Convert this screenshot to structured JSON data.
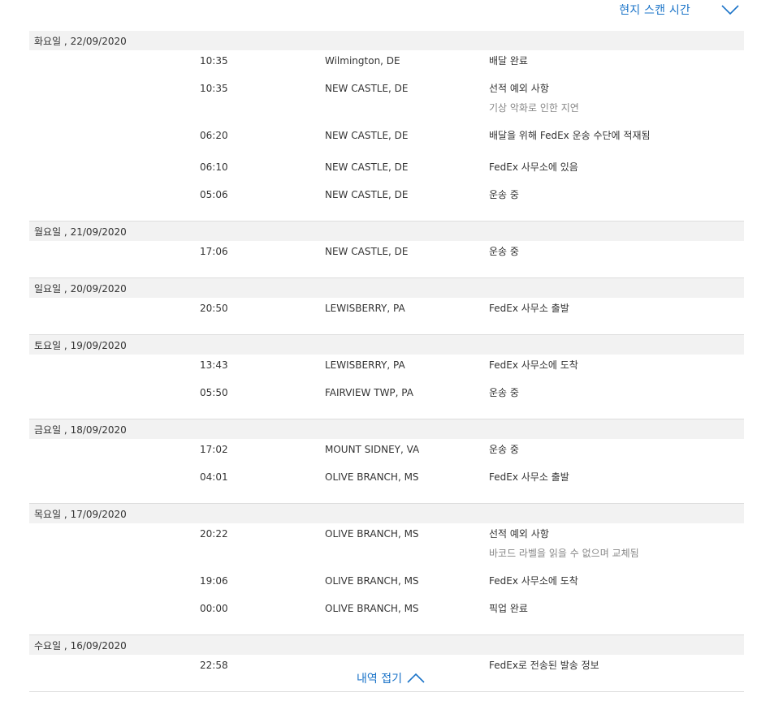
{
  "header": {
    "scan_time_label": "현지 스캔 시간"
  },
  "days": [
    {
      "date": "화요일 , 22/09/2020",
      "events": [
        {
          "time": "10:35",
          "location": "Wilmington, DE",
          "status": "배달 완료",
          "detail": ""
        },
        {
          "time": "10:35",
          "location": "NEW CASTLE, DE",
          "status": "선적 예외 사항",
          "detail": "기상 악화로 인한 지연"
        },
        {
          "time": "06:20",
          "location": "NEW CASTLE, DE",
          "status": " 배달을 위해 FedEx 운송 수단에 적재됨",
          "detail": ""
        },
        {
          "time": "06:10",
          "location": "NEW CASTLE, DE",
          "status": "FedEx 사무소에 있음",
          "detail": ""
        },
        {
          "time": "05:06",
          "location": "NEW CASTLE, DE",
          "status": "운송 중",
          "detail": ""
        }
      ]
    },
    {
      "date": "월요일 , 21/09/2020",
      "events": [
        {
          "time": "17:06",
          "location": "NEW CASTLE, DE",
          "status": "운송 중",
          "detail": ""
        }
      ]
    },
    {
      "date": "일요일 , 20/09/2020",
      "events": [
        {
          "time": "20:50",
          "location": "LEWISBERRY, PA",
          "status": "FedEx 사무소 출발",
          "detail": ""
        }
      ]
    },
    {
      "date": "토요일 , 19/09/2020",
      "events": [
        {
          "time": "13:43",
          "location": "LEWISBERRY, PA",
          "status": "FedEx 사무소에 도착",
          "detail": ""
        },
        {
          "time": "05:50",
          "location": "FAIRVIEW TWP, PA",
          "status": "운송 중",
          "detail": ""
        }
      ]
    },
    {
      "date": "금요일 , 18/09/2020",
      "events": [
        {
          "time": "17:02",
          "location": "MOUNT SIDNEY, VA",
          "status": "운송 중",
          "detail": ""
        },
        {
          "time": "04:01",
          "location": "OLIVE BRANCH, MS",
          "status": "FedEx 사무소 출발",
          "detail": ""
        }
      ]
    },
    {
      "date": "목요일 , 17/09/2020",
      "events": [
        {
          "time": "20:22",
          "location": "OLIVE BRANCH, MS",
          "status": "선적 예외 사항",
          "detail": "바코드 라벨을 읽을 수 없으며 교체됨"
        },
        {
          "time": "19:06",
          "location": "OLIVE BRANCH, MS",
          "status": "FedEx 사무소에 도착",
          "detail": ""
        },
        {
          "time": "00:00",
          "location": "OLIVE BRANCH, MS",
          "status": "픽업 완료",
          "detail": ""
        }
      ]
    },
    {
      "date": "수요일 , 16/09/2020",
      "events": [
        {
          "time": "22:58",
          "location": "",
          "status": "FedEx로 전송된 발송 정보",
          "detail": ""
        }
      ]
    }
  ],
  "footer": {
    "collapse_label": "내역 접기"
  },
  "colors": {
    "link": "#1a73c8",
    "day_header_bg": "#f2f2f2",
    "detail_text": "#888888"
  },
  "icons": {
    "scan_toggle": "chevron-down-icon",
    "collapse": "chevron-up-icon"
  }
}
